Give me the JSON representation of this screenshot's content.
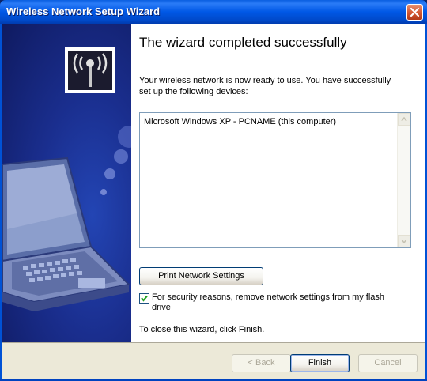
{
  "window": {
    "title": "Wireless Network Setup Wizard"
  },
  "content": {
    "heading": "The wizard completed successfully",
    "description": "Your wireless network is now ready to use. You have successfully set up the following devices:",
    "devices": [
      "Microsoft Windows XP - PCNAME (this computer)"
    ],
    "print_button": "Print Network Settings",
    "checkbox_label": "For security reasons, remove network settings from my flash drive",
    "checkbox_checked": true,
    "finish_note": "To close this wizard, click Finish."
  },
  "buttons": {
    "back": "< Back",
    "finish": "Finish",
    "cancel": "Cancel"
  },
  "icons": {
    "wizard": "wireless-antenna-icon",
    "close": "close-icon",
    "checkbox": "checkmark-icon"
  },
  "colors": {
    "titlebar": "#0058E6",
    "side_panel": "#1A2E8E",
    "close_button": "#D55A35"
  }
}
